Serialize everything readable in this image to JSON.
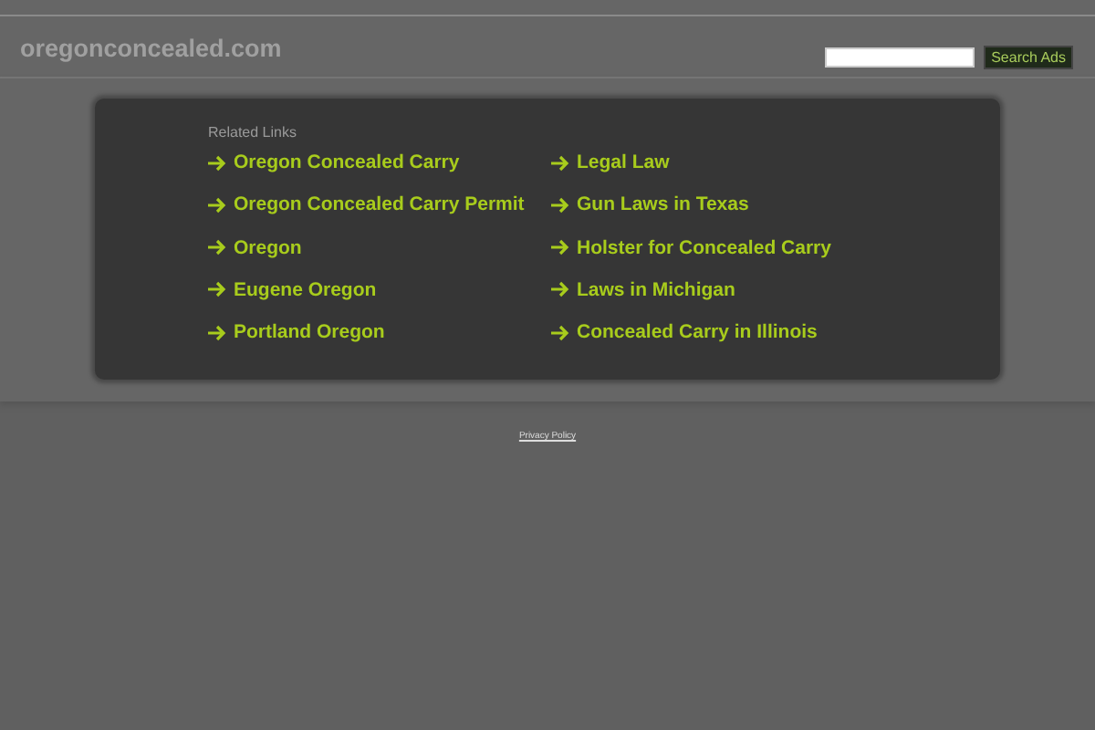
{
  "header": {
    "site_title": "oregonconcealed.com",
    "search": {
      "button": "Search Ads"
    }
  },
  "related": {
    "heading": "Related Links",
    "links": [
      "Oregon Concealed Carry",
      "Oregon Concealed Carry Permit",
      "Oregon",
      "Eugene Oregon",
      "Portland Oregon",
      "Legal Law",
      "Gun Laws in Texas",
      "Holster for Concealed Carry",
      "Laws in Michigan",
      "Concealed Carry in Illinois"
    ]
  },
  "footer": {
    "link": "Privacy Policy"
  }
}
